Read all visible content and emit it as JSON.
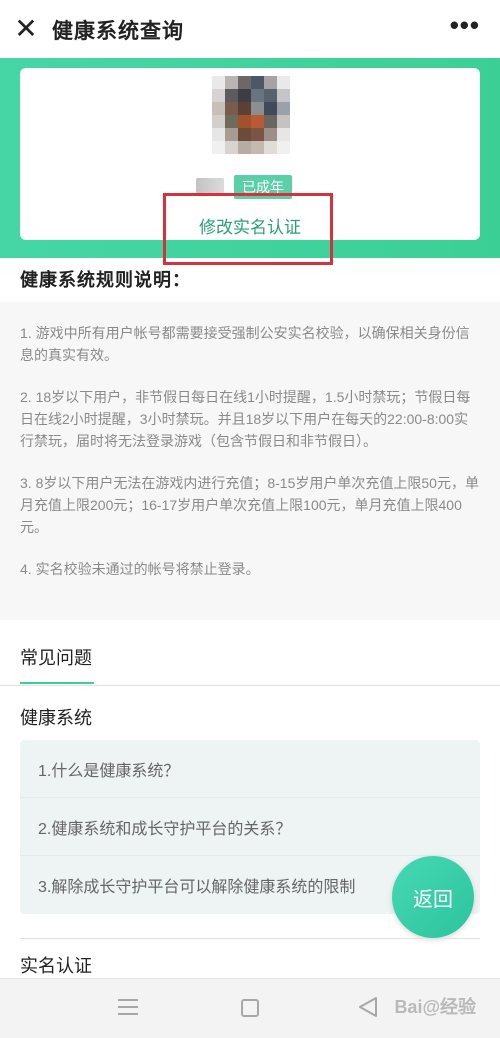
{
  "header": {
    "close_glyph": "✕",
    "title": "健康系统查询",
    "more_glyph": "•••"
  },
  "profile": {
    "status_badge": "已成年",
    "edit_link": "修改实名认证"
  },
  "rules": {
    "title": "健康系统规则说明：",
    "items": [
      "1. 游戏中所有用户帐号都需要接受强制公安实名校验，以确保相关身份信息的真实有效。",
      "2. 18岁以下用户，非节假日每日在线1小时提醒，1.5小时禁玩；节假日每日在线2小时提醒，3小时禁玩。并且18岁以下用户在每天的22:00-8:00实行禁玩，届时将无法登录游戏（包含节假日和非节假日）。",
      "3. 8岁以下用户无法在游戏内进行充值；8-15岁用户单次充值上限50元，单月充值上限200元；16-17岁用户单次充值上限100元，单月充值上限400元。",
      "4. 实名校验未通过的帐号将禁止登录。"
    ]
  },
  "faq": {
    "tab_label": "常见问题",
    "category_1": "健康系统",
    "questions": [
      "1.什么是健康系统？",
      "2.健康系统和成长守护平台的关系？",
      "3.解除成长守护平台可以解除健康系统的限制"
    ],
    "category_2": "实名认证"
  },
  "back_button": "返回",
  "watermark": "Bai@经验",
  "colors": {
    "accent": "#3ccf95",
    "highlight": "#d4333d",
    "link": "#2aa07a"
  }
}
